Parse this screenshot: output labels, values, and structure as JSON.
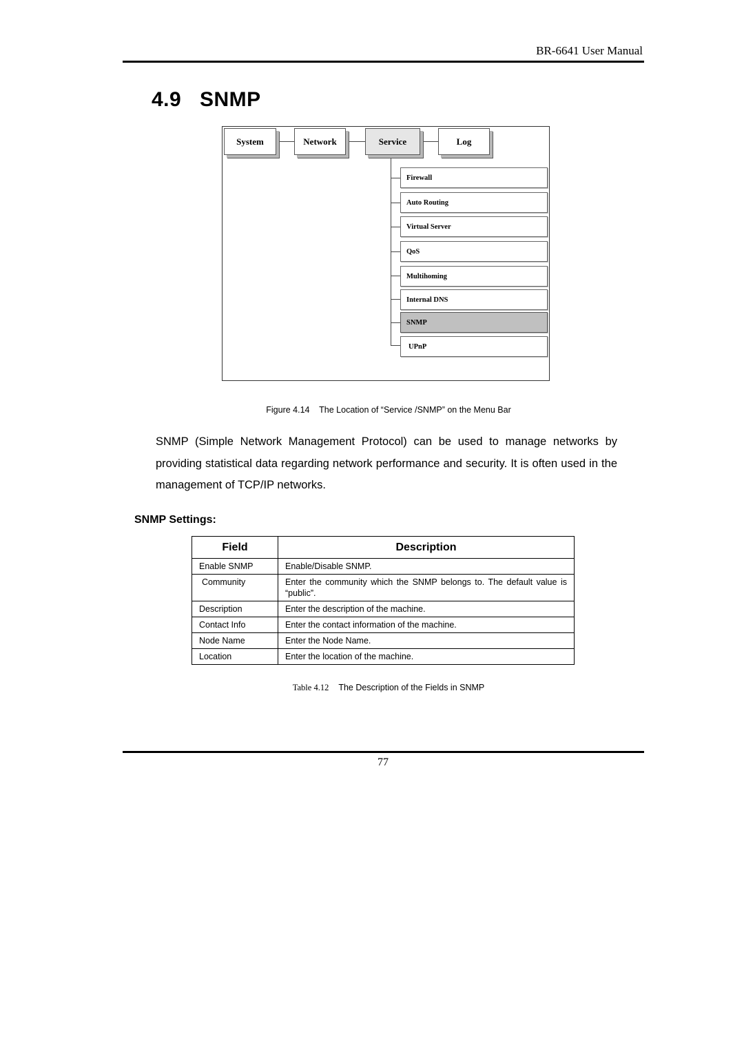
{
  "header": {
    "manual_title": "BR-6641 User Manual"
  },
  "section": {
    "number": "4.9",
    "title": "SNMP"
  },
  "figure": {
    "menu_tabs": [
      {
        "label": "System",
        "active": false
      },
      {
        "label": "Network",
        "active": false
      },
      {
        "label": "Service",
        "active": true
      },
      {
        "label": "Log",
        "active": false
      }
    ],
    "service_submenu": [
      {
        "label": "Firewall",
        "active": false
      },
      {
        "label": "Auto Routing",
        "active": false
      },
      {
        "label": "Virtual Server",
        "active": false
      },
      {
        "label": "QoS",
        "active": false
      },
      {
        "label": "Multihoming",
        "active": false
      },
      {
        "label": "Internal DNS",
        "active": false
      },
      {
        "label": "SNMP",
        "active": true
      },
      {
        "label": "UPnP",
        "active": false
      }
    ],
    "caption": "Figure 4.14    The Location of “Service /SNMP” on the Menu Bar"
  },
  "body": {
    "paragraph": "SNMP (Simple Network Management Protocol) can be used to manage networks by providing statistical data regarding network performance and security. It is often used in the management of TCP/IP networks.",
    "subheading": "SNMP Settings:"
  },
  "table": {
    "headers": {
      "field": "Field",
      "description": "Description"
    },
    "rows": [
      {
        "field": "Enable SNMP",
        "description": "Enable/Disable SNMP."
      },
      {
        "field": "Community",
        "description": "Enter the community which the SNMP belongs to. The default value is “public”."
      },
      {
        "field": "Description",
        "description": "Enter the description of the machine."
      },
      {
        "field": "Contact Info",
        "description": "Enter the contact information of the machine."
      },
      {
        "field": "Node Name",
        "description": "Enter the Node Name."
      },
      {
        "field": "Location",
        "description": "Enter the location of the machine."
      }
    ],
    "caption_label": "Table 4.12",
    "caption_text": "The Description of the Fields in SNMP"
  },
  "footer": {
    "page_number": "77"
  }
}
